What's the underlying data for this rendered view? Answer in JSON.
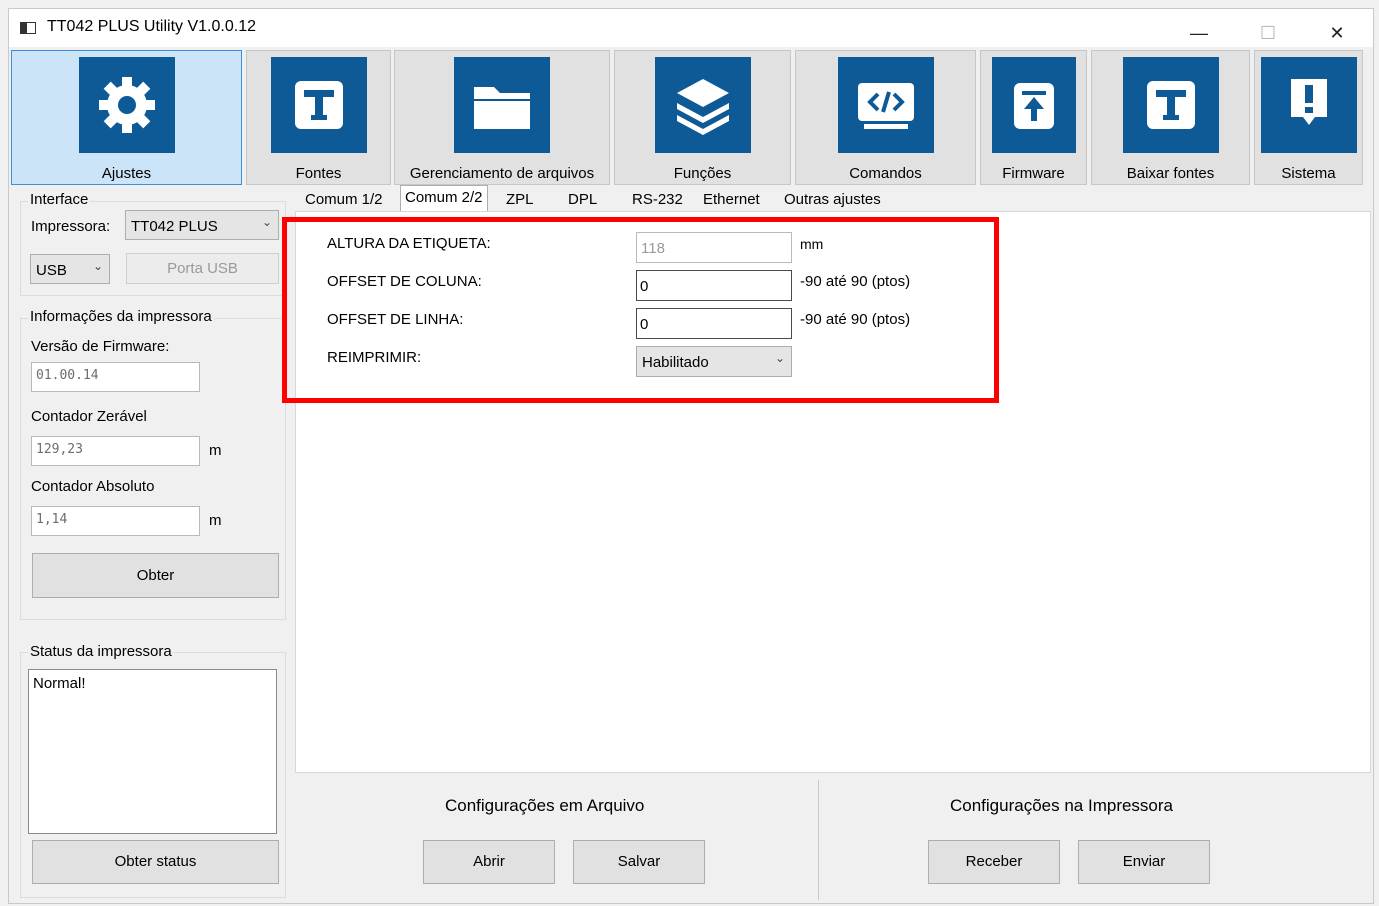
{
  "window": {
    "title": "TT042 PLUS Utility  V1.0.0.12",
    "controls": {
      "minimize": "—",
      "maximize": "☐",
      "close": "✕"
    }
  },
  "toolbar": {
    "items": [
      {
        "label": "Ajustes",
        "icon": "gear-icon"
      },
      {
        "label": "Fontes",
        "icon": "font-t-icon"
      },
      {
        "label": "Gerenciamento de arquivos",
        "icon": "folder-icon"
      },
      {
        "label": "Funções",
        "icon": "layers-icon"
      },
      {
        "label": "Comandos",
        "icon": "code-icon"
      },
      {
        "label": "Firmware",
        "icon": "upload-icon"
      },
      {
        "label": "Baixar fontes",
        "icon": "font-t-icon"
      },
      {
        "label": "Sistema",
        "icon": "exclamation-icon"
      }
    ],
    "active": "Ajustes",
    "accent_color": "#0e5a96"
  },
  "sidebar": {
    "interface": {
      "title": "Interface",
      "printer_label": "Impressora:",
      "printer_value": "TT042 PLUS",
      "port_value": "USB",
      "port_button": "Porta USB"
    },
    "info": {
      "title": "Informações da impressora",
      "firmware_label": "Versão de Firmware:",
      "firmware_value": "01.00.14",
      "reset_counter_label": "Contador Zerável",
      "reset_counter_value": "129,23",
      "reset_counter_unit": "m",
      "abs_counter_label": "Contador Absoluto",
      "abs_counter_value": "1,14",
      "abs_counter_unit": "m",
      "get_button": "Obter"
    },
    "status": {
      "title": "Status da impressora",
      "text": "Normal!",
      "button": "Obter status"
    }
  },
  "tabs": {
    "items": [
      "Comum 1/2",
      "Comum 2/2",
      "ZPL",
      "DPL",
      "RS-232",
      "Ethernet",
      "Outras ajustes"
    ],
    "active": "Comum 2/2"
  },
  "form": {
    "label_height": {
      "label": "ALTURA DA ETIQUETA:",
      "value": "118",
      "unit": "mm"
    },
    "column_offset": {
      "label": "OFFSET DE COLUNA:",
      "value": "0",
      "hint": "-90 até 90 (ptos)"
    },
    "row_offset": {
      "label": "OFFSET DE LINHA:",
      "value": "0",
      "hint": "-90 até 90 (ptos)"
    },
    "reprint": {
      "label": "REIMPRIMIR:",
      "value": "Habilitado"
    },
    "highlight_color": "#ff0000"
  },
  "bottom": {
    "file": {
      "title": "Configurações em Arquivo",
      "open": "Abrir",
      "save": "Salvar"
    },
    "printer": {
      "title": "Configurações na Impressora",
      "receive": "Receber",
      "send": "Enviar"
    }
  }
}
